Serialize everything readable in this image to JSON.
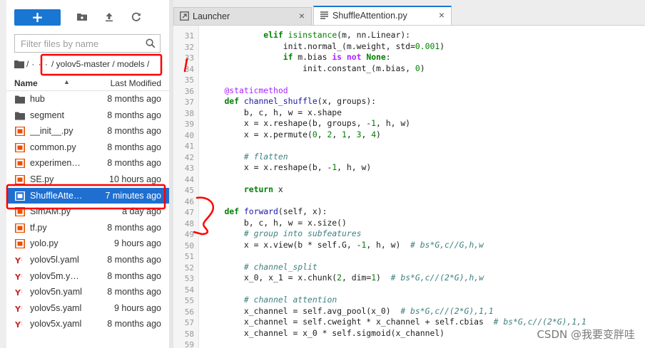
{
  "toolbar": {
    "new_label": "+"
  },
  "filter": {
    "placeholder": "Filter files by name"
  },
  "breadcrumb": {
    "root": "/",
    "ellipsis": "· · ·",
    "path": "/ yolov5-master / models /"
  },
  "file_list": {
    "header_name": "Name",
    "header_modified": "Last Modified",
    "items": [
      {
        "type": "folder",
        "name": "hub",
        "modified": "8 months ago"
      },
      {
        "type": "folder",
        "name": "segment",
        "modified": "8 months ago"
      },
      {
        "type": "python",
        "name": "__init__.py",
        "modified": "8 months ago"
      },
      {
        "type": "python",
        "name": "common.py",
        "modified": "8 months ago"
      },
      {
        "type": "python",
        "name": "experimen…",
        "modified": "8 months ago"
      },
      {
        "type": "python",
        "name": "SE.py",
        "modified": "10 hours ago"
      },
      {
        "type": "python",
        "name": "ShuffleAtte…",
        "modified": "7 minutes ago",
        "selected": true
      },
      {
        "type": "python",
        "name": "SimAM.py",
        "modified": "a day ago"
      },
      {
        "type": "python",
        "name": "tf.py",
        "modified": "8 months ago"
      },
      {
        "type": "python",
        "name": "yolo.py",
        "modified": "9 hours ago"
      },
      {
        "type": "yaml",
        "name": "yolov5l.yaml",
        "modified": "8 months ago"
      },
      {
        "type": "yaml",
        "name": "yolov5m.y…",
        "modified": "8 months ago"
      },
      {
        "type": "yaml",
        "name": "yolov5n.yaml",
        "modified": "8 months ago"
      },
      {
        "type": "yaml",
        "name": "yolov5s.yaml",
        "modified": "9 hours ago"
      },
      {
        "type": "yaml",
        "name": "yolov5x.yaml",
        "modified": "8 months ago"
      }
    ]
  },
  "tabs": [
    {
      "label": "Launcher",
      "close": "×",
      "active": false
    },
    {
      "label": "ShuffleAttention.py",
      "close": "×",
      "active": true
    }
  ],
  "editor": {
    "line_numbers": [
      "31",
      "32",
      "33",
      "34",
      "35",
      "36",
      "37",
      "38",
      "39",
      "40",
      "41",
      "42",
      "43",
      "44",
      "45",
      "46",
      "47",
      "48",
      "49",
      "50",
      "51",
      "52",
      "53",
      "54",
      "55",
      "56",
      "57",
      "58",
      "59"
    ],
    "lines": [
      "            elif isinstance(m, nn.Linear):",
      "                init.normal_(m.weight, std=0.001)",
      "                if m.bias is not None:",
      "                    init.constant_(m.bias, 0)",
      "",
      "    @staticmethod",
      "    def channel_shuffle(x, groups):",
      "        b, c, h, w = x.shape",
      "        x = x.reshape(b, groups, -1, h, w)",
      "        x = x.permute(0, 2, 1, 3, 4)",
      "",
      "        # flatten",
      "        x = x.reshape(b, -1, h, w)",
      "",
      "        return x",
      "",
      "    def forward(self, x):",
      "        b, c, h, w = x.size()",
      "        # group into subfeatures",
      "        x = x.view(b * self.G, -1, h, w)  # bs*G,c//G,h,w",
      "",
      "        # channel_split",
      "        x_0, x_1 = x.chunk(2, dim=1)  # bs*G,c//(2*G),h,w",
      "",
      "        # channel attention",
      "        x_channel = self.avg_pool(x_0)  # bs*G,c//(2*G),1,1",
      "        x_channel = self.cweight * x_channel + self.cbias  # bs*G,c//(2*G),1,1",
      "        x_channel = x_0 * self.sigmoid(x_channel)",
      ""
    ]
  },
  "watermark": "CSDN @我要变胖哇",
  "colors": {
    "accent": "#1976d2",
    "selection": "#1e6fd0",
    "annotation": "#ff0000"
  }
}
